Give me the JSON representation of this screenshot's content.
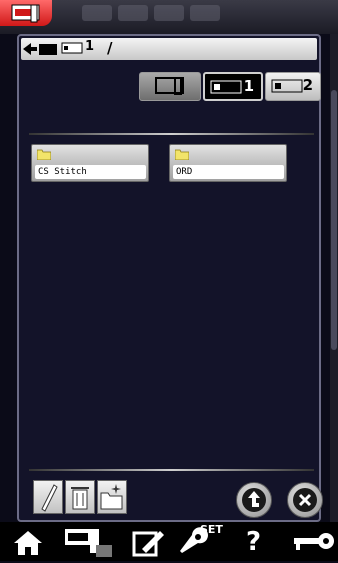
{
  "path": {
    "usb_label": "1",
    "text": "/"
  },
  "devices": [
    {
      "name": "sewing-machine",
      "label": ""
    },
    {
      "name": "usb-1",
      "label": "1"
    },
    {
      "name": "usb-2",
      "label": "2"
    }
  ],
  "folders": [
    {
      "name": "CS Stitch"
    },
    {
      "name": "ORD"
    }
  ],
  "nav": {
    "set_label": "SET",
    "help_label": "?"
  },
  "colors": {
    "accent_red": "#d01818",
    "panel_bg": "#131329",
    "border": "#6c6c86"
  }
}
